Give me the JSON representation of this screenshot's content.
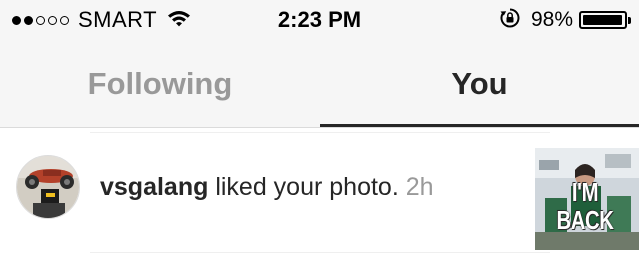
{
  "status_bar": {
    "signal_filled_dots": 2,
    "signal_total_dots": 5,
    "carrier": "SMART",
    "time": "2:23 PM",
    "battery_percent": "98%",
    "battery_level": 0.98,
    "icons": [
      "wifi-icon",
      "rotation-lock-icon",
      "battery-icon"
    ]
  },
  "tabs": [
    {
      "label": "Following",
      "active": false
    },
    {
      "label": "You",
      "active": true
    }
  ],
  "notifications": [
    {
      "username": "vsgalang",
      "action": " liked your photo.",
      "time": "2h",
      "thumbnail_caption": "I'M BACK"
    }
  ],
  "colors": {
    "bar_background": "#f6f6f6",
    "inactive_tab": "#999999",
    "active_tab": "#262626",
    "timestamp": "#999999"
  }
}
